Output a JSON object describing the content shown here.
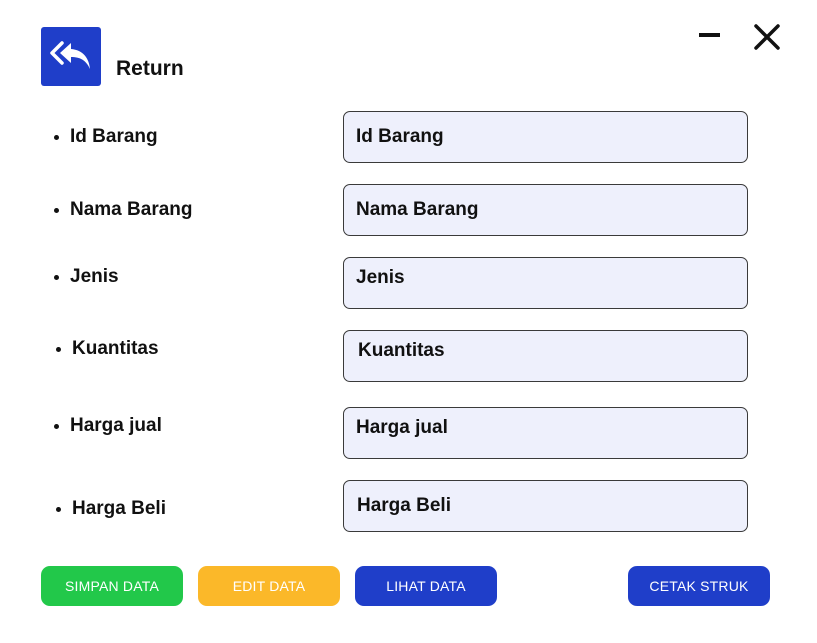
{
  "header": {
    "title": "Return",
    "return_icon": "double-reply-icon",
    "minimize_icon": "minimize-icon",
    "close_icon": "close-icon"
  },
  "form": {
    "fields": [
      {
        "label": "Id Barang",
        "placeholder": "Id Barang"
      },
      {
        "label": "Nama Barang",
        "placeholder": "Nama Barang"
      },
      {
        "label": "Jenis",
        "placeholder": "Jenis"
      },
      {
        "label": "Kuantitas",
        "placeholder": "Kuantitas"
      },
      {
        "label": "Harga jual",
        "placeholder": "Harga jual"
      },
      {
        "label": "Harga Beli",
        "placeholder": "Harga Beli"
      }
    ]
  },
  "actions": {
    "simpan": "SIMPAN DATA",
    "edit": "EDIT DATA",
    "lihat": "LIHAT DATA",
    "cetak": "CETAK STRUK"
  },
  "colors": {
    "primary": "#1f3ec9",
    "success": "#22c84a",
    "warning": "#fbb829",
    "field_bg": "#eef0fc"
  }
}
